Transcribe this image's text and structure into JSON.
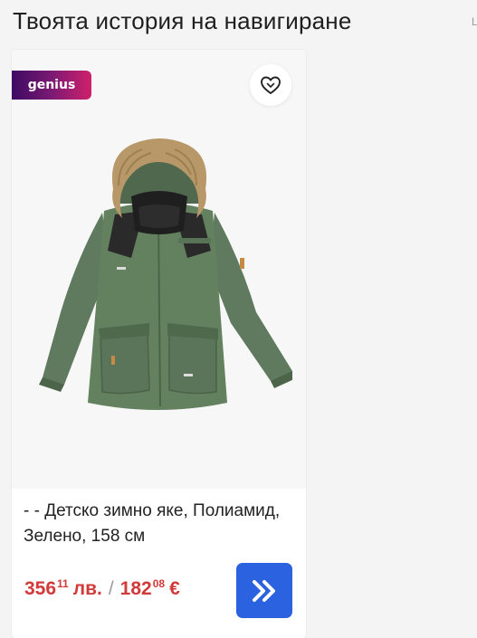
{
  "page": {
    "title": "Твоята история на навигиране",
    "edge_glyph": "L"
  },
  "product": {
    "badge": "genius",
    "wishlist_icon": "heart-icon",
    "name": "- - Детско зимно яке, Полиамид, Зелено, 158 см",
    "price_bgn": {
      "int": "356",
      "dec": "11",
      "currency": "лв."
    },
    "separator": "/",
    "price_eur": {
      "int": "182",
      "dec": "08",
      "currency": "€"
    },
    "action_icon": "double-chevron-right-icon"
  },
  "colors": {
    "price": "#d23a3a",
    "action_button": "#2a62e0",
    "badge_gradient": [
      "#3d0a63",
      "#d0206b"
    ],
    "jacket": "#5f7a5e",
    "fur": "#b89868"
  }
}
